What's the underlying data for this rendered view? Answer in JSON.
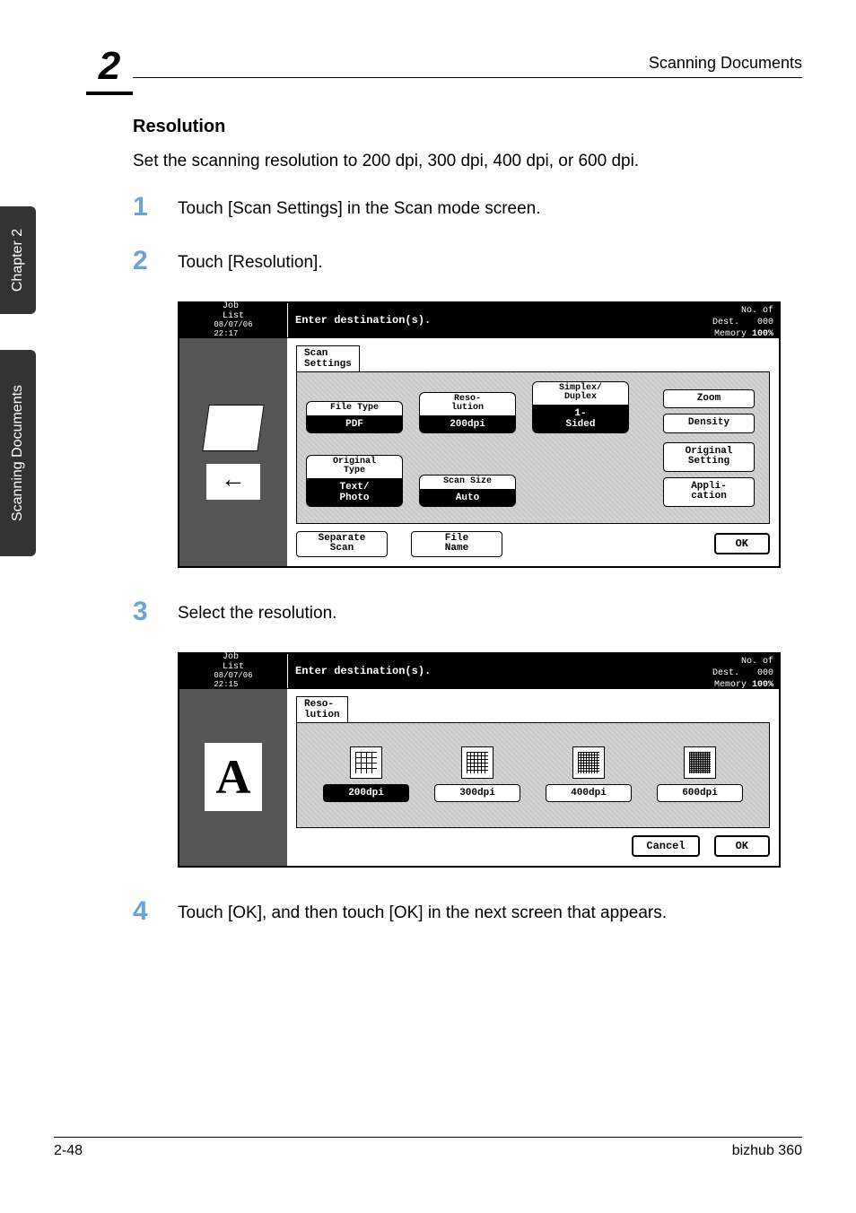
{
  "header": {
    "chapter_num": "2",
    "right_title": "Scanning Documents"
  },
  "side_tabs": {
    "tab1": "Chapter 2",
    "tab2": "Scanning Documents"
  },
  "section_title": "Resolution",
  "intro_text": "Set the scanning resolution to 200 dpi, 300 dpi, 400 dpi, or 600 dpi.",
  "steps": {
    "s1": {
      "num": "1",
      "text": "Touch [Scan Settings] in the Scan mode screen."
    },
    "s2": {
      "num": "2",
      "text": "Touch [Resolution]."
    },
    "s3": {
      "num": "3",
      "text": "Select the resolution."
    },
    "s4": {
      "num": "4",
      "text": "Touch [OK], and then touch [OK] in the next screen that appears."
    }
  },
  "ss1": {
    "joblist": "Job\nList",
    "datetime": "08/07/06\n22:17",
    "header_msg": "Enter destination(s).",
    "no_of_dest_label": "No. of\nDest.",
    "no_of_dest_val": "000",
    "memory_label": "Memory",
    "memory_val": "100%",
    "tab": "Scan\nSettings",
    "filetype_label": "File Type",
    "filetype_val": "PDF",
    "resolution_label": "Reso-\nlution",
    "resolution_val": "200dpi",
    "simplex_label": "Simplex/\nDuplex",
    "simplex_val": "1-\nSided",
    "original_label": "Original\nType",
    "original_val": "Text/\nPhoto",
    "scansize_label": "Scan Size",
    "scansize_val": "Auto",
    "separate": "Separate\nScan",
    "filename": "File\nName",
    "zoom": "Zoom",
    "density": "Density",
    "origsetting": "Original\nSetting",
    "application": "Appli-\ncation",
    "ok": "OK"
  },
  "ss2": {
    "joblist": "Job\nList",
    "datetime": "08/07/06\n22:15",
    "header_msg": "Enter destination(s).",
    "no_of_dest_label": "No. of\nDest.",
    "no_of_dest_val": "000",
    "memory_label": "Memory",
    "memory_val": "100%",
    "tab": "Reso-\nlution",
    "r200": "200dpi",
    "r300": "300dpi",
    "r400": "400dpi",
    "r600": "600dpi",
    "cancel": "Cancel",
    "ok": "OK"
  },
  "footer": {
    "left": "2-48",
    "right": "bizhub 360"
  }
}
